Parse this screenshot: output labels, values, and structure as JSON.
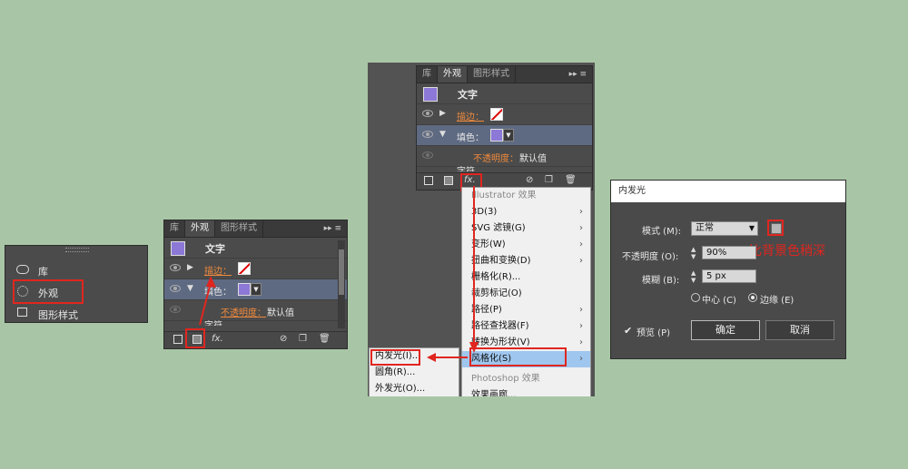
{
  "panel_small": {
    "items": [
      {
        "label": "库",
        "icon": "creative-cloud-icon"
      },
      {
        "label": "外观",
        "icon": "appearance-icon"
      },
      {
        "label": "图形样式",
        "icon": "graphic-styles-icon"
      }
    ]
  },
  "appearance": {
    "tabs": [
      "库",
      "外观",
      "图形样式"
    ],
    "title": "文字",
    "stroke_label": "描边：",
    "fill_label": "填色：",
    "opacity_label": "不透明度：",
    "opacity_value": "默认值",
    "partial_label": "字符",
    "fx_label": "fx."
  },
  "menu": {
    "section_illustrator": "Illustrator 效果",
    "items": [
      "3D(3)",
      "SVG 滤镜(G)",
      "变形(W)",
      "扭曲和变换(D)",
      "栅格化(R)...",
      "裁剪标记(O)",
      "路径(P)",
      "路径查找器(F)",
      "转换为形状(V)",
      "风格化(S)"
    ],
    "section_photoshop": "Photoshop 效果",
    "partial_item": "效果画廊...",
    "submenu": [
      "内发光(I)...",
      "圆角(R)...",
      "外发光(O)..."
    ]
  },
  "dialog": {
    "title": "内发光",
    "mode_label": "模式 (M):",
    "mode_value": "正常",
    "opacity_label": "不透明度 (O):",
    "opacity_value": "90%",
    "blur_label": "模糊 (B):",
    "blur_value": "5 px",
    "center_label": "中心 (C)",
    "edge_label": "边缘 (E)",
    "preview_label": "预览 (P)",
    "ok_label": "确定",
    "cancel_label": "取消",
    "annotation": "比背景色稍深",
    "swatch_color": "#b7b7b7"
  },
  "colors": {
    "background": "#a8c6a6",
    "panel": "#4b4b4b",
    "accent_red": "#e0261f",
    "fill_swatch": "#8c78d6",
    "orange_link": "#f08a3c"
  }
}
